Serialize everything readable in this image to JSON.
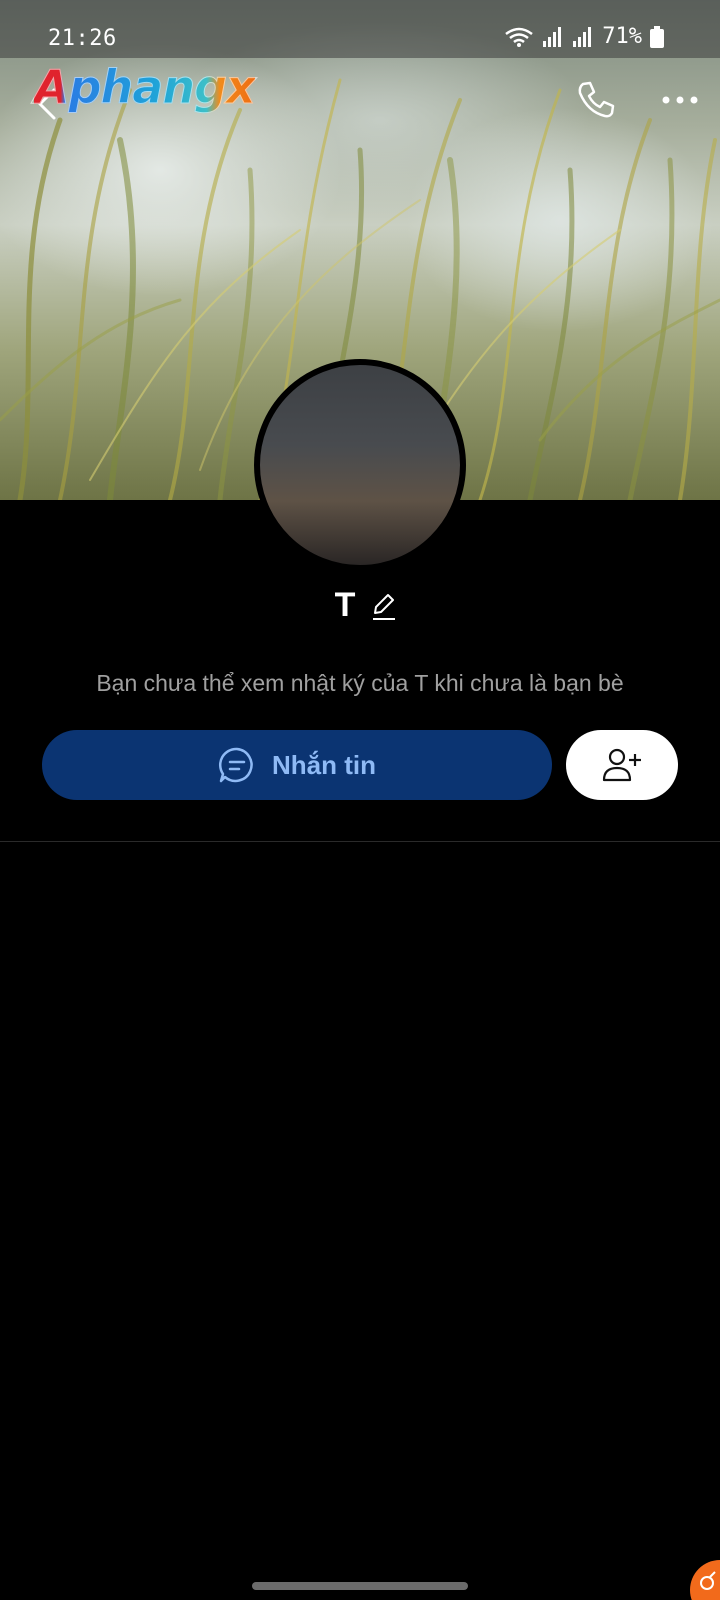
{
  "status_bar": {
    "time": "21:26",
    "battery": "71%",
    "icons": [
      "wifi-icon",
      "signal-icon",
      "signal-icon",
      "battery-icon"
    ]
  },
  "header": {
    "watermark": "Aphangx",
    "icons": [
      "back-arrow-icon",
      "phone-icon",
      "more-dots-icon"
    ]
  },
  "profile": {
    "name": "T",
    "notice": "Bạn chưa thể xem nhật ký của T khi chưa là bạn bè"
  },
  "actions": {
    "message_label": "Nhắn tin",
    "message_icon": "chat-bubble-icon",
    "add_friend_icon": "add-friend-icon"
  },
  "colors": {
    "message_button_bg": "#0b3472",
    "message_button_text": "#8fbaf5",
    "background": "#000000",
    "badge": "#f26a1b"
  }
}
